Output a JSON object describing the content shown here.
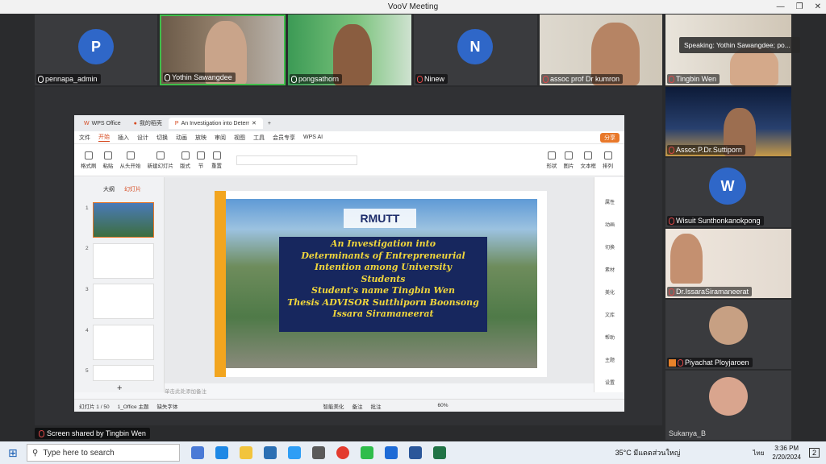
{
  "window": {
    "title": "VooV Meeting"
  },
  "top_row": [
    {
      "name": "pennapa_admin",
      "avatar_letter": "P",
      "muted": false
    },
    {
      "name": "Yothin Sawangdee",
      "muted": false
    },
    {
      "name": "pongsathorn",
      "muted": false
    },
    {
      "name": "Ninew",
      "avatar_letter": "N",
      "muted": true
    },
    {
      "name": "assoc prof Dr kumron",
      "muted": true
    }
  ],
  "right_column": [
    {
      "name": "Tingbin Wen",
      "muted": true
    },
    {
      "name": "Assoc.P.Dr.Suttiporn",
      "muted": true
    },
    {
      "name": "Wisuit  Sunthonkanokpong",
      "avatar_letter": "W",
      "muted": true
    },
    {
      "name": "Dr.IssaraSiramaneerat",
      "muted": true
    },
    {
      "name": "Piyachat Ployjaroen",
      "muted": true
    },
    {
      "name": "Sukanya_B",
      "muted": false
    }
  ],
  "speaking_label": "Speaking:  Yothin Sawangdee; po...",
  "screen_share_label": "Screen shared by Tingbin Wen",
  "wps": {
    "tabs": [
      "WPS Office",
      "我的稻壳",
      "An Investigation into Deterr"
    ],
    "menu": [
      "文件",
      "开始",
      "插入",
      "设计",
      "切换",
      "动画",
      "放映",
      "审阅",
      "视图",
      "工具",
      "会员专享",
      "WPS AI"
    ],
    "share": "分享",
    "ribbon": [
      "格式刷",
      "粘贴",
      "从头开始",
      "新建幻灯片",
      "版式",
      "节",
      "重置",
      "形状",
      "图片",
      "文本框",
      "排列"
    ],
    "panel_tabs": [
      "大纲",
      "幻灯片"
    ],
    "slide_numbers": [
      "1",
      "2",
      "3",
      "4",
      "5"
    ],
    "notes_placeholder": "单击此处添加备注",
    "status": {
      "slide_count": "幻灯片 1 / 50",
      "theme": "1_Office 主题",
      "missing_font": "缺失字体",
      "beautify": "智能美化",
      "notes": "备注",
      "comments": "批注",
      "zoom": "60%"
    },
    "right_tools": [
      "属性",
      "动画",
      "切换",
      "素材",
      "美化",
      "文库",
      "帮助",
      "主题",
      "设置"
    ]
  },
  "slide": {
    "logo": "RMUTT",
    "lines": [
      "An Investigation into",
      "Determinants of Entrepreneurial",
      "Intention among University",
      "Students",
      "Student's name  Tingbin Wen",
      "Thesis ADVISOR   Sutthiporn Boonsong",
      "Issara Siramaneerat"
    ]
  },
  "taskbar": {
    "search_placeholder": "Type here to search",
    "weather": "35°C  มีแดดส่วนใหญ่",
    "lang": "ไทย",
    "time": "3:36 PM",
    "date": "2/20/2024",
    "notifications": "2"
  }
}
